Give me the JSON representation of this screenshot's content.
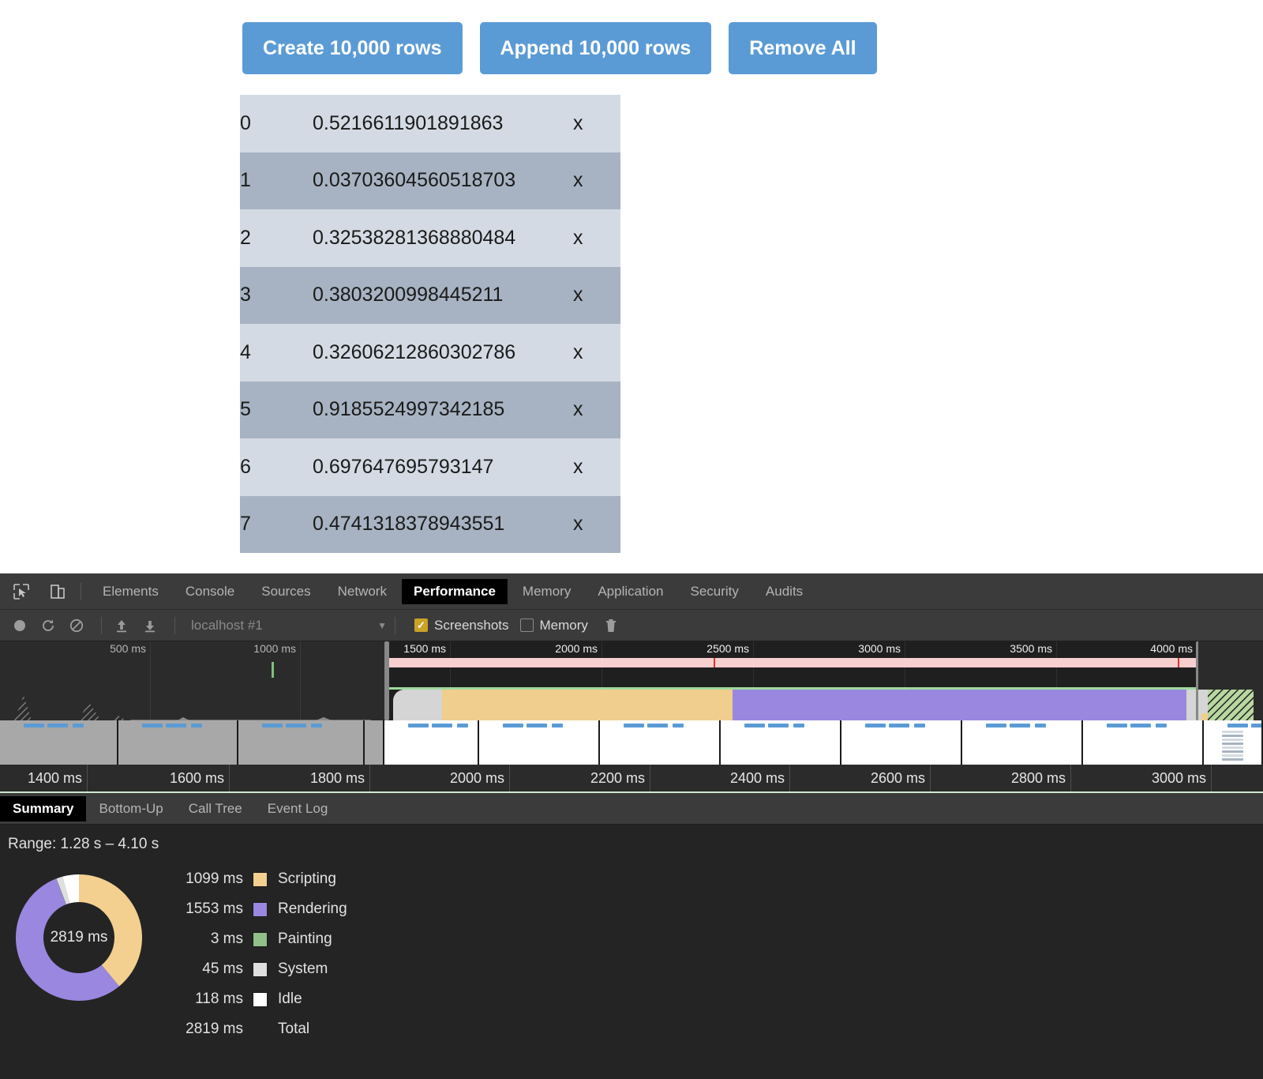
{
  "page": {
    "buttons": [
      {
        "label": "Create 10,000 rows",
        "name": "create-rows-button"
      },
      {
        "label": "Append 10,000 rows",
        "name": "append-rows-button"
      },
      {
        "label": "Remove All",
        "name": "remove-all-button"
      }
    ],
    "table": {
      "delete_label": "x",
      "rows": [
        {
          "id": "0",
          "value": "0.5216611901891863"
        },
        {
          "id": "1",
          "value": "0.03703604560518703"
        },
        {
          "id": "2",
          "value": "0.32538281368880484"
        },
        {
          "id": "3",
          "value": "0.3803200998445211"
        },
        {
          "id": "4",
          "value": "0.32606212860302786"
        },
        {
          "id": "5",
          "value": "0.9185524997342185"
        },
        {
          "id": "6",
          "value": "0.697647695793147"
        },
        {
          "id": "7",
          "value": "0.4741318378943551"
        }
      ]
    }
  },
  "devtools": {
    "panel_tabs": [
      {
        "label": "Elements",
        "active": false
      },
      {
        "label": "Console",
        "active": false
      },
      {
        "label": "Sources",
        "active": false
      },
      {
        "label": "Network",
        "active": false
      },
      {
        "label": "Performance",
        "active": true
      },
      {
        "label": "Memory",
        "active": false
      },
      {
        "label": "Application",
        "active": false
      },
      {
        "label": "Security",
        "active": false
      },
      {
        "label": "Audits",
        "active": false
      }
    ],
    "toolbar": {
      "session_label": "localhost #1",
      "screenshots_label": "Screenshots",
      "screenshots_checked": true,
      "memory_label": "Memory",
      "memory_checked": false,
      "check_glyph": "✓"
    },
    "overview": {
      "left_ticks": [
        "500 ms",
        "1000 ms"
      ],
      "window_ticks": [
        "1500 ms",
        "2000 ms",
        "2500 ms",
        "3000 ms",
        "3500 ms",
        "4000 ms"
      ]
    },
    "bottom_ruler_ticks": [
      "1400 ms",
      "1600 ms",
      "1800 ms",
      "2000 ms",
      "2200 ms",
      "2400 ms",
      "2600 ms",
      "2800 ms",
      "3000 ms"
    ],
    "lower_tabs": [
      {
        "label": "Summary",
        "active": true
      },
      {
        "label": "Bottom-Up",
        "active": false
      },
      {
        "label": "Call Tree",
        "active": false
      },
      {
        "label": "Event Log",
        "active": false
      }
    ],
    "summary": {
      "range_text": "Range: 1.28 s – 4.10 s",
      "donut_center": "2819 ms",
      "total_row": {
        "value": "2819 ms",
        "label": "Total"
      }
    }
  },
  "colors": {
    "accent_button": "#5b9bd5",
    "scripting": "#f3d090",
    "rendering": "#9a87e0",
    "painting": "#91c089",
    "system": "#dfdfdf",
    "idle": "#ffffff",
    "row_odd": "#d3dae3",
    "row_even": "#a7b3c2"
  },
  "chart_data": {
    "type": "pie",
    "title": "Performance activity breakdown",
    "center_label": "2819 ms",
    "categories": [
      "Scripting",
      "Rendering",
      "Painting",
      "System",
      "Idle"
    ],
    "values": [
      1099,
      1553,
      3,
      45,
      118
    ],
    "value_labels": [
      "1099 ms",
      "1553 ms",
      "3 ms",
      "45 ms",
      "118 ms"
    ],
    "colors": [
      "#f3d090",
      "#9a87e0",
      "#91c089",
      "#dfdfdf",
      "#ffffff"
    ],
    "unit": "ms",
    "total": 2819,
    "total_label": "2819 ms",
    "legend_position": "right"
  }
}
